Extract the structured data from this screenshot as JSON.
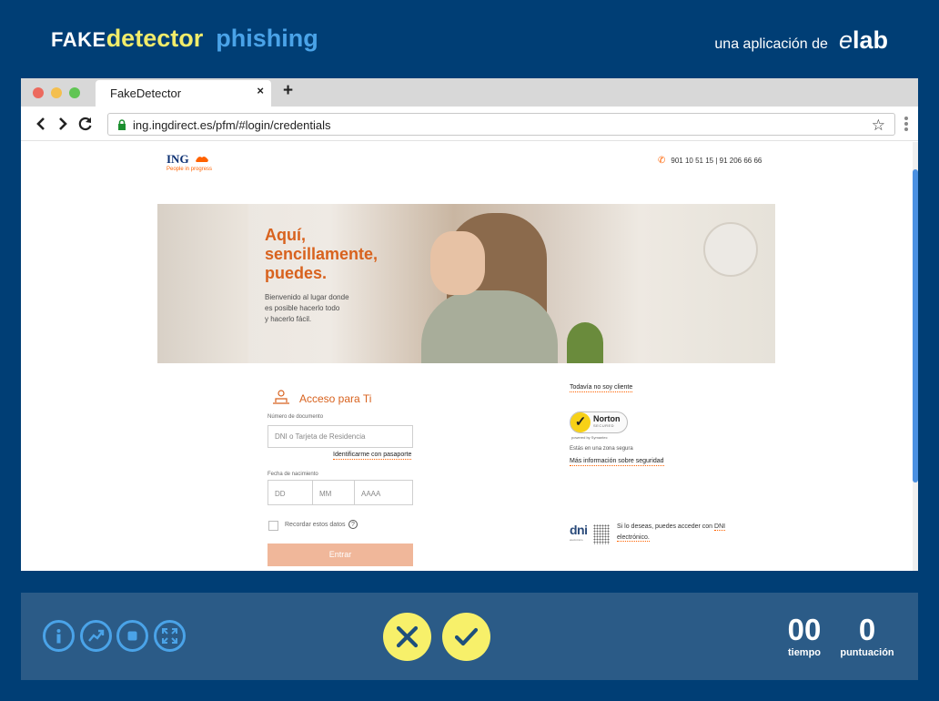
{
  "app": {
    "logo_fake": "FAKE",
    "logo_detector": "detector",
    "mode": "phishing",
    "credit_text": "una aplicación de",
    "credit_brand_e": "e",
    "credit_brand_rest": "lab"
  },
  "browser": {
    "tab_title": "FakeDetector",
    "tab_close": "×",
    "new_tab": "+",
    "url": "ing.ingdirect.es/pfm/#login/credentials",
    "star": "☆"
  },
  "page": {
    "logo": "ING",
    "logo_tagline": "People in progress",
    "phone": "901 10 51 15 | 91 206 66 66",
    "hero_title_lines": [
      "Aquí,",
      "sencillamente,",
      "puedes."
    ],
    "hero_sub_lines": [
      "Bienvenido al lugar donde",
      "es posible hacerlo todo",
      "y hacerlo fácil."
    ],
    "access_title": "Acceso para Ti",
    "doc_label": "Número de documento",
    "doc_placeholder": "DNI o Tarjeta de Residencia",
    "passport_link": "Identificarme con pasaporte",
    "birth_label": "Fecha de nacimiento",
    "dd": "DD",
    "mm": "MM",
    "yyyy": "AAAA",
    "remember": "Recordar estos datos",
    "help": "?",
    "enter_button": "Entrar",
    "not_client_link": "Todavía no soy cliente",
    "norton_name": "Norton",
    "norton_secured": "SECURED",
    "norton_powered": "powered by Symantec",
    "safe_zone": "Estás en una zona segura",
    "more_security_link": "Más información sobre seguridad",
    "dni_logo": "dni",
    "dni_logo_sub": "electrónico",
    "dni_text_1": "Si lo deseas, puedes acceder con ",
    "dni_text_link": "DNI electrónico.",
    "colors": {
      "brand_orange": "#ff6200",
      "ing_blue": "#0b2f72"
    }
  },
  "controls": {
    "icons": [
      "info-icon",
      "stats-icon",
      "stop-icon",
      "fullscreen-icon"
    ],
    "reject_icon": "x-icon",
    "accept_icon": "check-icon",
    "time_value": "00",
    "time_label": "tiempo",
    "score_value": "0",
    "score_label": "puntuación"
  },
  "colors": {
    "background": "#003e75",
    "panel": "#2b5b87",
    "accent_yellow": "#f7f06a",
    "accent_blue": "#4aa3e8"
  }
}
